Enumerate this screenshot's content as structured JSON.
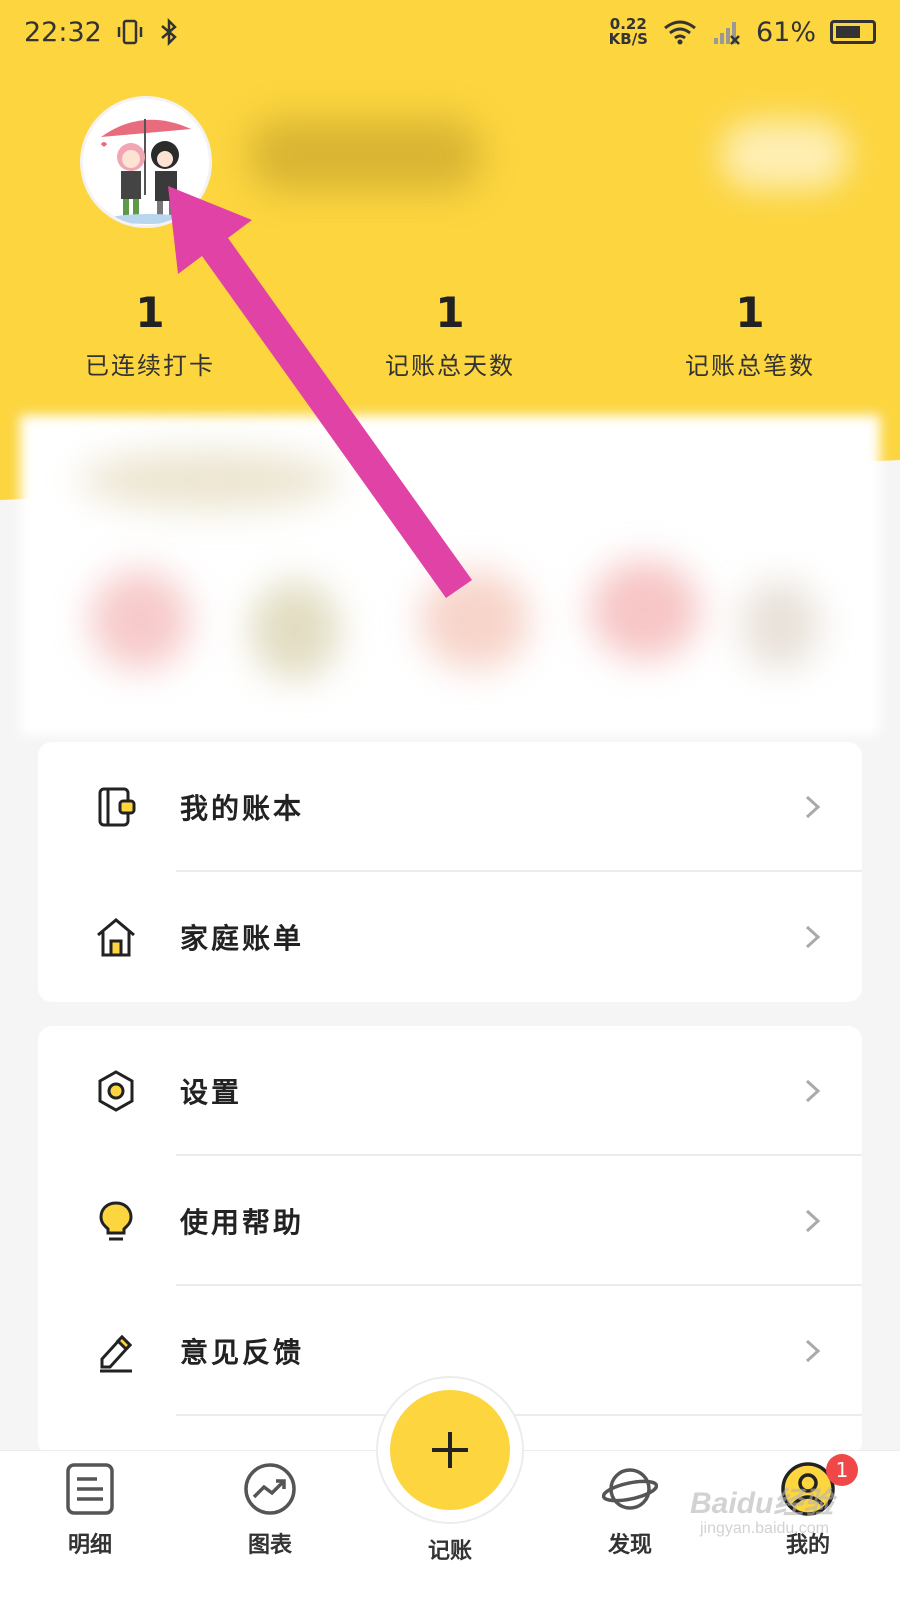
{
  "status_bar": {
    "time": "22:32",
    "net_speed_value": "0.22",
    "net_speed_unit": "KB/S",
    "battery": "61%"
  },
  "profile": {
    "avatar_icon": "anime-couple-umbrella-avatar"
  },
  "stats": [
    {
      "value": "1",
      "label": "已连续打卡"
    },
    {
      "value": "1",
      "label": "记账总天数"
    },
    {
      "value": "1",
      "label": "记账总笔数"
    }
  ],
  "menu_group_1": [
    {
      "label": "我的账本",
      "icon": "wallet-icon"
    },
    {
      "label": "家庭账单",
      "icon": "house-icon"
    }
  ],
  "menu_group_2": [
    {
      "label": "设置",
      "icon": "gear-icon"
    },
    {
      "label": "使用帮助",
      "icon": "lightbulb-icon"
    },
    {
      "label": "意见反馈",
      "icon": "pencil-icon"
    }
  ],
  "tabbar": {
    "tabs": [
      {
        "label": "明细",
        "icon": "list-icon"
      },
      {
        "label": "图表",
        "icon": "chart-icon"
      },
      {
        "label": "记账",
        "icon": "plus-icon"
      },
      {
        "label": "发现",
        "icon": "planet-icon"
      },
      {
        "label": "我的",
        "icon": "person-icon"
      }
    ],
    "badge_count": "1"
  },
  "watermark": {
    "brand": "Baidu经验",
    "url": "jingyan.baidu.com"
  },
  "colors": {
    "accent": "#fcd53f",
    "arrow": "#e043a5",
    "badge": "#f04848"
  }
}
